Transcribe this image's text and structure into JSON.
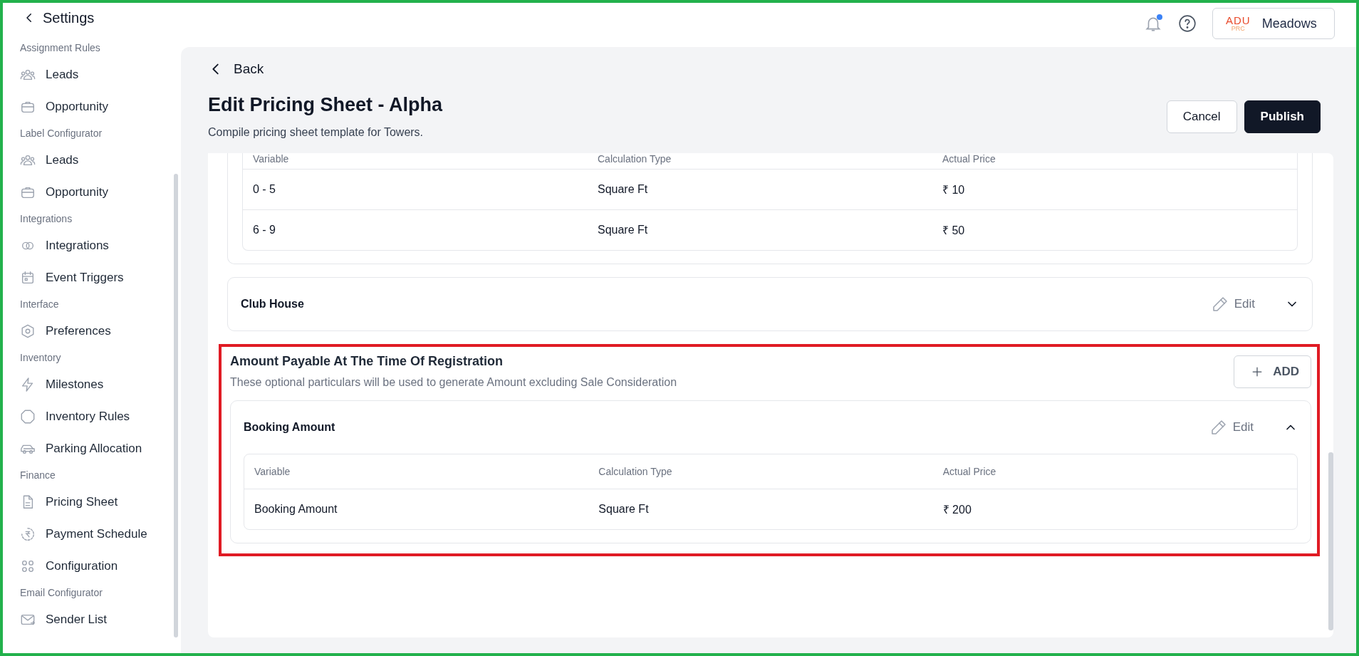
{
  "top_bar": {
    "back_label": "Settings",
    "has_notification": true,
    "account": {
      "logo_top": "ADU",
      "logo_bottom": "PRC",
      "name": "Meadows"
    }
  },
  "sidebar": {
    "groups": [
      {
        "label": "Assignment Rules",
        "items": [
          "Leads",
          "Opportunity"
        ]
      },
      {
        "label": "Label Configurator",
        "items": [
          "Leads",
          "Opportunity"
        ]
      },
      {
        "label": "Integrations",
        "items": [
          "Integrations",
          "Event Triggers"
        ]
      },
      {
        "label": "Interface",
        "items": [
          "Preferences"
        ]
      },
      {
        "label": "Inventory",
        "items": [
          "Milestones",
          "Inventory Rules",
          "Parking Allocation"
        ]
      },
      {
        "label": "Finance",
        "items": [
          "Pricing Sheet",
          "Payment Schedule",
          "Configuration"
        ]
      },
      {
        "label": "Email Configurator",
        "items": [
          "Sender List"
        ]
      }
    ]
  },
  "page": {
    "back": "Back",
    "title": "Edit Pricing Sheet - Alpha",
    "subtitle": "Compile pricing sheet template for Towers.",
    "cancel": "Cancel",
    "publish": "Publish"
  },
  "cards": [
    {
      "expanded": true,
      "table": {
        "columns": [
          "Variable",
          "Calculation Type",
          "Actual Price"
        ],
        "rows": [
          [
            "0 - 5",
            "Square Ft",
            "₹ 10"
          ],
          [
            "6 - 9",
            "Square Ft",
            "₹ 50"
          ]
        ]
      }
    },
    {
      "title": "Club House",
      "edit": "Edit",
      "expanded": false
    }
  ],
  "section": {
    "title": "Amount Payable At The Time Of Registration",
    "description": "These optional particulars will be used to generate Amount excluding Sale Consideration",
    "add": "ADD",
    "cards": [
      {
        "title": "Booking Amount",
        "edit": "Edit",
        "expanded": true,
        "table": {
          "columns": [
            "Variable",
            "Calculation Type",
            "Actual Price"
          ],
          "rows": [
            [
              "Booking Amount",
              "Square Ft",
              "₹ 200"
            ]
          ]
        }
      }
    ]
  }
}
